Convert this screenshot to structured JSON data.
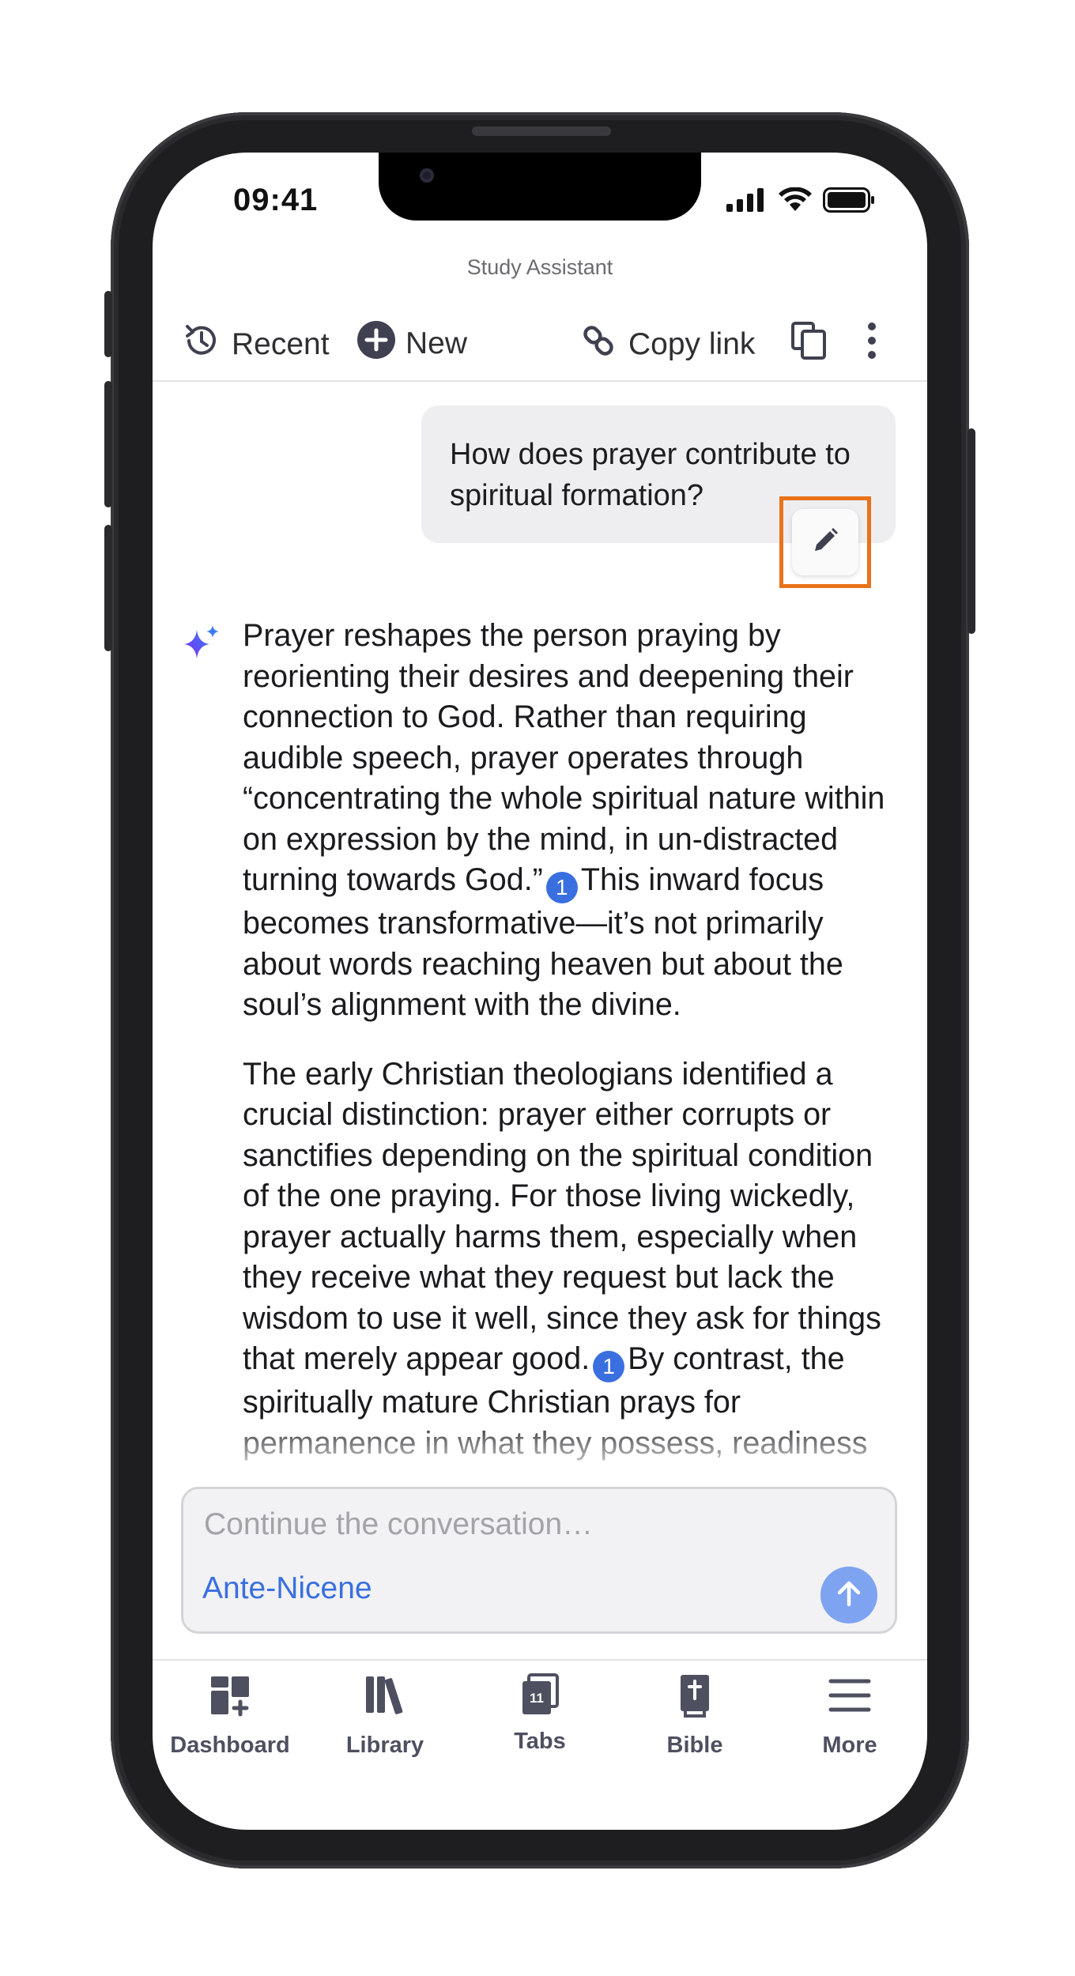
{
  "status_bar": {
    "time": "09:41"
  },
  "app": {
    "title": "Study Assistant"
  },
  "toolbar": {
    "recent_label": "Recent",
    "new_label": "New",
    "copy_link_label": "Copy link"
  },
  "conversation": {
    "user_message": "How does prayer contribute to spiritual formation?",
    "answer": {
      "p1_before_cite": "Prayer reshapes the person praying by reorienting their desires and deepening their connection to God. Rather than requiring audible speech, prayer operates through “concentrating the whole spiritual nature within on expression by the mind, in un-distracted turning towards God.”",
      "p1_cite": "1",
      "p1_after_cite": "This inward focus becomes transformative—it’s not primarily about words reaching heaven but about the soul’s alignment with the divine.",
      "p2_before_cite": "The early Christian theologians identified a crucial distinction: prayer either corrupts or sanctifies depending on the spiritual condition of the one praying. For those living wickedly, prayer actually harms them, especially when they receive what they request but lack the wisdom to use it well, since they ask for things that merely appear good.",
      "p2_cite": "1",
      "p2_after_cite": "By contrast, the spiritually mature Christian prays for permanence in what they possess, readiness"
    }
  },
  "composer": {
    "placeholder": "Continue the conversation…",
    "collection": "Ante-Nicene"
  },
  "bottom_nav": {
    "items": [
      {
        "label": "Dashboard",
        "icon": "dashboard-icon"
      },
      {
        "label": "Library",
        "icon": "library-icon"
      },
      {
        "label": "Tabs",
        "icon": "tabs-icon",
        "badge": "11"
      },
      {
        "label": "Bible",
        "icon": "bible-icon"
      },
      {
        "label": "More",
        "icon": "menu-icon"
      }
    ]
  },
  "colors": {
    "accent": "#3a6fe0",
    "send_button": "#7ea3f1",
    "highlight_outline": "#e8731a",
    "nav_icon": "#4e5060"
  }
}
